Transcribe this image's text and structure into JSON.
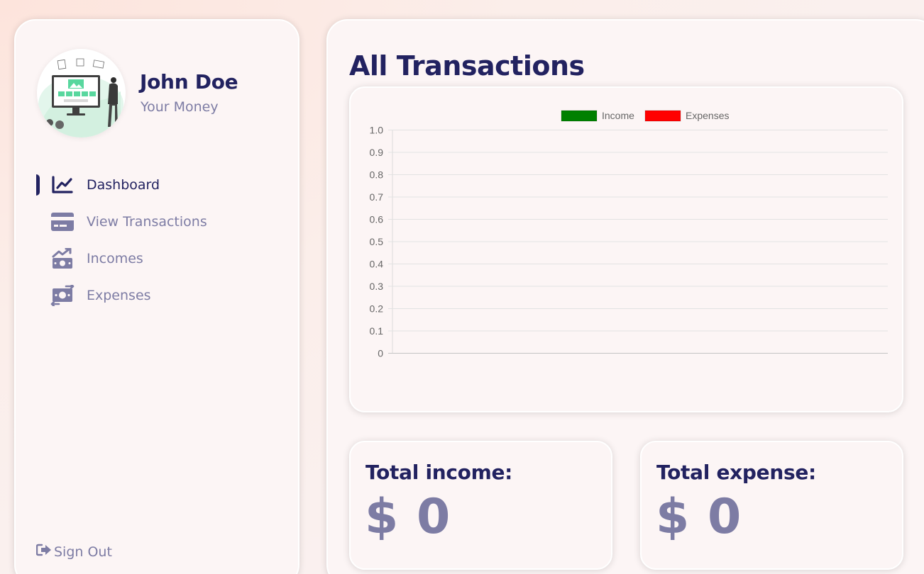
{
  "user": {
    "name": "John Doe",
    "subtitle": "Your Money"
  },
  "nav": [
    {
      "label": "Dashboard",
      "icon": "chart-line-icon",
      "active": true
    },
    {
      "label": "View Transactions",
      "icon": "credit-card-icon",
      "active": false
    },
    {
      "label": "Incomes",
      "icon": "money-bill-trend-up-icon",
      "active": false
    },
    {
      "label": "Expenses",
      "icon": "money-bill-transfer-icon",
      "active": false
    }
  ],
  "signout": {
    "label": "Sign Out",
    "icon": "sign-out-icon"
  },
  "main": {
    "title": "All Transactions"
  },
  "stats": {
    "income": {
      "label": "Total income:",
      "value": "$ 0"
    },
    "expense": {
      "label": "Total expense:",
      "value": "$ 0"
    }
  },
  "colors": {
    "primary": "#222260",
    "muted": "#7d7ca4",
    "income": "#008000",
    "expense": "#ff0000"
  },
  "chart_data": {
    "type": "line",
    "x": [],
    "series": [
      {
        "name": "Income",
        "color": "#008000",
        "values": []
      },
      {
        "name": "Expenses",
        "color": "#ff0000",
        "values": []
      }
    ],
    "ylim": [
      0,
      1.0
    ],
    "yticks": [
      "0",
      "0.1",
      "0.2",
      "0.3",
      "0.4",
      "0.5",
      "0.6",
      "0.7",
      "0.8",
      "0.9",
      "1.0"
    ],
    "grid": true,
    "legend": "top-center"
  }
}
